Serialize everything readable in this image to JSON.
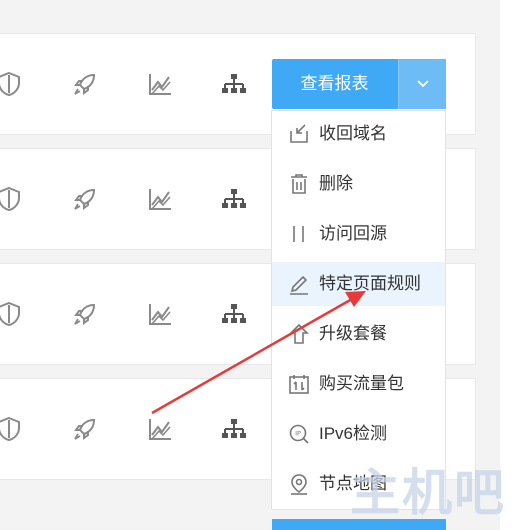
{
  "report_button": {
    "label": "查看报表"
  },
  "dropdown_menu": {
    "items": [
      {
        "label": "收回域名",
        "icon": "retract-icon"
      },
      {
        "label": "删除",
        "icon": "trash-icon"
      },
      {
        "label": "访问回源",
        "icon": "origin-icon"
      },
      {
        "label": "特定页面规则",
        "icon": "pencil-icon",
        "highlighted": true
      },
      {
        "label": "升级套餐",
        "icon": "upgrade-icon"
      },
      {
        "label": "购买流量包",
        "icon": "traffic-package-icon"
      },
      {
        "label": "IPv6检测",
        "icon": "ipv6-icon"
      },
      {
        "label": "节点地图",
        "icon": "map-pin-icon"
      }
    ]
  },
  "row_actions": [
    "shield-icon",
    "rocket-icon",
    "chart-icon",
    "sitemap-icon"
  ],
  "watermark": {
    "text": "主机吧"
  },
  "colors": {
    "primary": "#3fa9f5",
    "caret": "#6dbcf6",
    "highlight": "#e9f4fe",
    "arrow": "#e83a3a",
    "icon": "#8a8a8a"
  }
}
